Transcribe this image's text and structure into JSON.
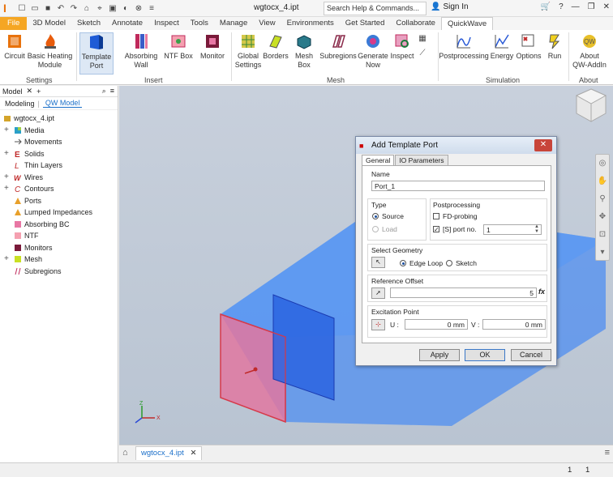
{
  "titlebar": {
    "doc_title": "wgtocx_4.ipt",
    "search_placeholder": "Search Help & Commands...",
    "signin_label": "Sign In"
  },
  "ribbon_tabs": [
    "File",
    "3D Model",
    "Sketch",
    "Annotate",
    "Inspect",
    "Tools",
    "Manage",
    "View",
    "Environments",
    "Get Started",
    "Collaborate",
    "QuickWave"
  ],
  "active_tab": "QuickWave",
  "ribbon": {
    "settings": {
      "label": "Settings",
      "buttons": [
        "Circuit",
        "Basic Heating\nModule"
      ]
    },
    "insert": {
      "label": "Insert",
      "buttons": [
        "Template\nPort",
        "Absorbing\nWall",
        "NTF Box",
        "Monitor"
      ]
    },
    "mesh": {
      "label": "Mesh",
      "buttons": [
        "Global\nSettings",
        "Borders",
        "Mesh\nBox",
        "Subregions",
        "Generate\nNow",
        "Inspect"
      ]
    },
    "simulation": {
      "label": "Simulation",
      "buttons": [
        "Postprocessing",
        "Energy",
        "Options",
        "Run"
      ]
    },
    "about": {
      "label": "About",
      "buttons": [
        "About\nQW-AddIn"
      ]
    }
  },
  "panel": {
    "title": "Model",
    "tabs": [
      "Modeling",
      "QW Model"
    ],
    "root": "wgtocx_4.ipt",
    "items": [
      {
        "label": "Media",
        "expandable": true
      },
      {
        "label": "Movements",
        "expandable": false
      },
      {
        "label": "Solids",
        "expandable": true
      },
      {
        "label": "Thin Layers",
        "expandable": false
      },
      {
        "label": "Wires",
        "expandable": true
      },
      {
        "label": "Contours",
        "expandable": true
      },
      {
        "label": "Ports",
        "expandable": false
      },
      {
        "label": "Lumped Impedances",
        "expandable": false
      },
      {
        "label": "Absorbing BC",
        "expandable": false
      },
      {
        "label": "NTF",
        "expandable": false
      },
      {
        "label": "Monitors",
        "expandable": false
      },
      {
        "label": "Mesh",
        "expandable": true
      },
      {
        "label": "Subregions",
        "expandable": false
      }
    ]
  },
  "dialog": {
    "title": "Add Template Port",
    "tabs": [
      "General",
      "IO Parameters"
    ],
    "name_label": "Name",
    "name_value": "Port_1",
    "type_label": "Type",
    "type_options": [
      "Source",
      "Load"
    ],
    "type_selected": "Source",
    "post_label": "Postprocessing",
    "fd_probing_label": "FD-probing",
    "sport_label": "[S] port no.",
    "sport_value": "1",
    "geom_label": "Select Geometry",
    "geom_options": [
      "Edge Loop",
      "Sketch"
    ],
    "geom_selected": "Edge Loop",
    "ref_label": "Reference Offset",
    "ref_value": "5",
    "exc_label": "Excitation Point",
    "u_label": "U :",
    "u_value": "0 mm",
    "v_label": "V :",
    "v_value": "0 mm",
    "apply_label": "Apply",
    "ok_label": "OK",
    "cancel_label": "Cancel",
    "fx_label": "fx"
  },
  "doc_tabs": {
    "tab_label": "wgtocx_4.ipt"
  },
  "status": {
    "a": "1",
    "b": "1"
  },
  "colors": {
    "accent": "#1a6fc9",
    "file_tab": "#f5a623",
    "model_blue": "#4f8ef0",
    "port_red": "#d63a4a"
  }
}
